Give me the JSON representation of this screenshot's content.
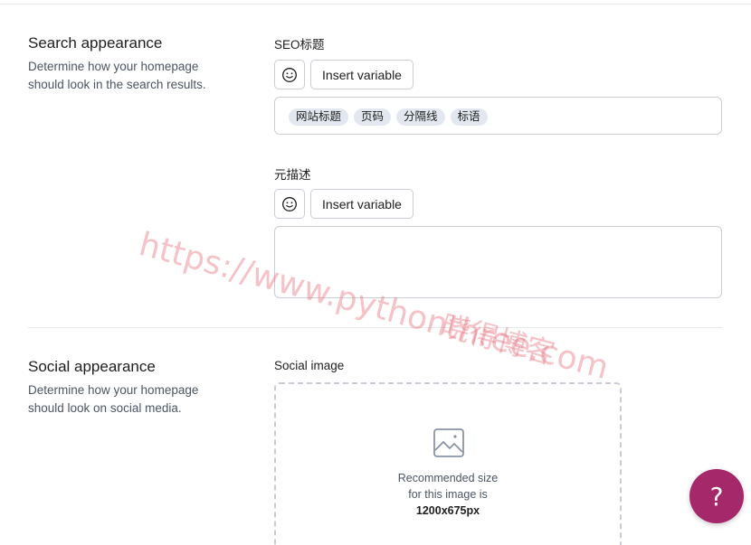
{
  "search_appearance": {
    "title": "Search appearance",
    "description": "Determine how your homepage should look in the search results.",
    "seo_title": {
      "label": "SEO标题",
      "insert_variable_label": "Insert variable",
      "chips": [
        "网站标题",
        "页码",
        "分隔线",
        "标语"
      ]
    },
    "meta_description": {
      "label": "元描述",
      "insert_variable_label": "Insert variable",
      "value": ""
    }
  },
  "social_appearance": {
    "title": "Social appearance",
    "description": "Determine how your homepage should look on social media.",
    "social_image": {
      "label": "Social image",
      "hint_line1": "Recommended size",
      "hint_line2": "for this image is",
      "hint_size": "1200x675px"
    }
  },
  "help_button": {
    "label": "?"
  },
  "watermark": {
    "url": "https://www.pythonthree.com",
    "brand": "晓得博客"
  },
  "colors": {
    "accent": "#a4286a",
    "chip_bg": "#e3e8f0",
    "border": "#c9cdd4"
  }
}
